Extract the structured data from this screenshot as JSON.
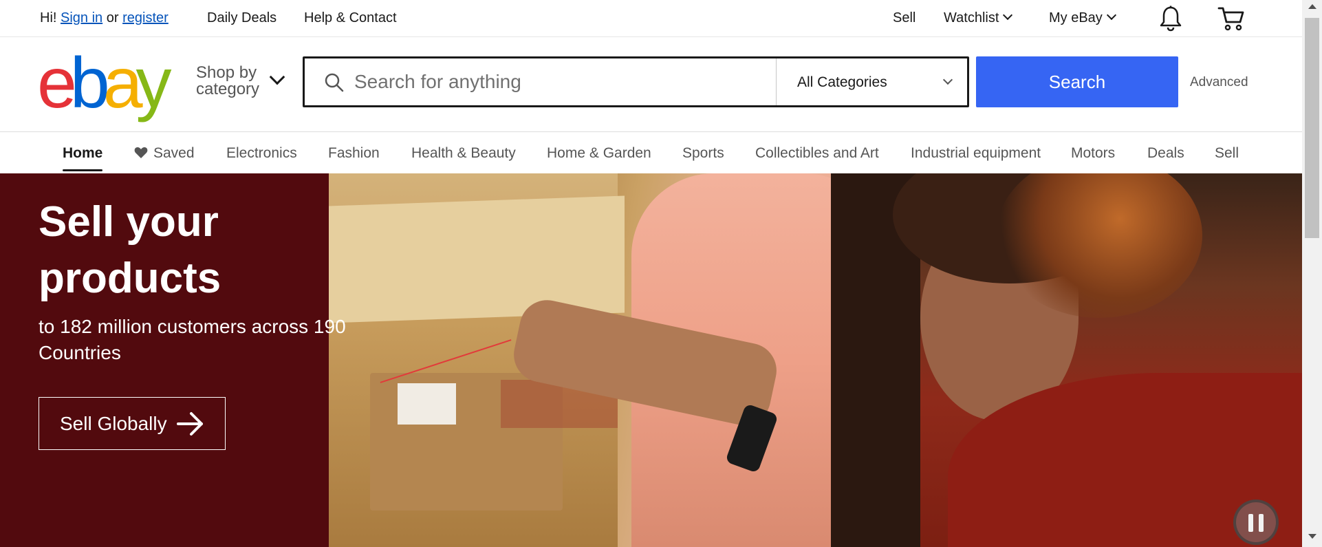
{
  "topbar": {
    "greeting": "Hi!",
    "sign_in": "Sign in",
    "or": "or",
    "register": "register",
    "daily_deals": "Daily Deals",
    "help_contact": "Help & Contact",
    "sell": "Sell",
    "watchlist": "Watchlist",
    "my_ebay": "My eBay",
    "icons": [
      "bell-icon",
      "cart-icon"
    ]
  },
  "header": {
    "logo_letters": [
      "e",
      "b",
      "a",
      "y"
    ],
    "logo_colors": [
      "#e53238",
      "#0064d2",
      "#f5af02",
      "#86b817"
    ],
    "shop_by_line1": "Shop by",
    "shop_by_line2": "category",
    "search_placeholder": "Search for anything",
    "category_selected": "All Categories",
    "search_button": "Search",
    "advanced": "Advanced",
    "accent_color": "#3665f3"
  },
  "nav": {
    "items": [
      {
        "label": "Home",
        "active": true
      },
      {
        "label": "Saved"
      },
      {
        "label": "Electronics"
      },
      {
        "label": "Fashion"
      },
      {
        "label": "Health & Beauty"
      },
      {
        "label": "Home & Garden"
      },
      {
        "label": "Sports"
      },
      {
        "label": "Collectibles and Art"
      },
      {
        "label": "Industrial equipment"
      },
      {
        "label": "Motors"
      },
      {
        "label": "Deals"
      },
      {
        "label": "Sell"
      }
    ]
  },
  "hero": {
    "title_line1": "Sell your",
    "title_line2": "products",
    "subtitle": "to 182 million customers across 190 Countries",
    "button_label": "Sell Globally",
    "background_color": "#520a0e"
  }
}
